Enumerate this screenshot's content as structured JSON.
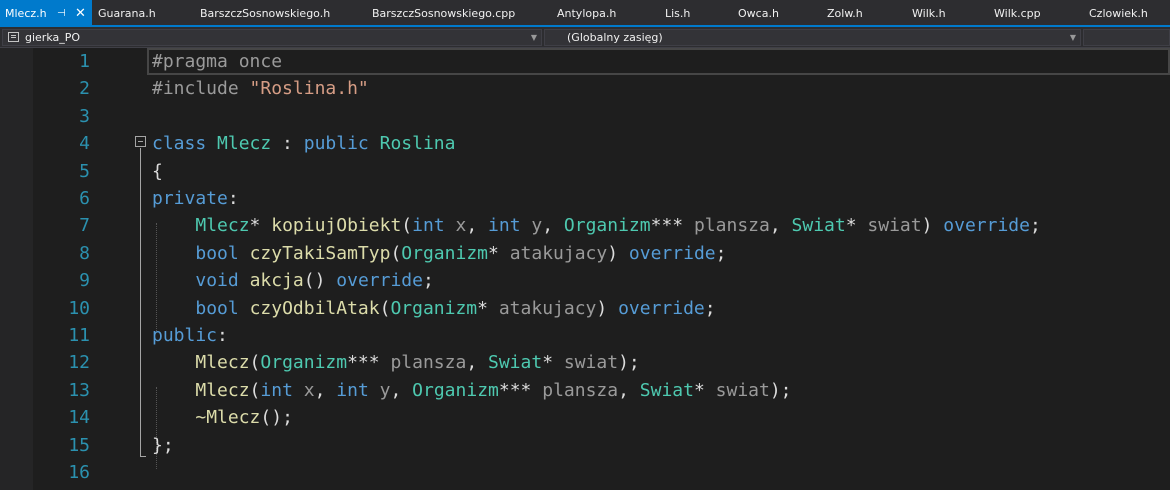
{
  "tabs": [
    {
      "label": "Mlecz.h",
      "active": true
    },
    {
      "label": "Guarana.h"
    },
    {
      "label": "BarszczSosnowskiego.h"
    },
    {
      "label": "BarszczSosnowskiego.cpp"
    },
    {
      "label": "Antylopa.h"
    },
    {
      "label": "Lis.h"
    },
    {
      "label": "Owca.h"
    },
    {
      "label": "Zolw.h"
    },
    {
      "label": "Wilk.h"
    },
    {
      "label": "Wilk.cpp"
    },
    {
      "label": "Czlowiek.h"
    }
  ],
  "navbar": {
    "project": "gierka_PO",
    "scope": "(Globalny zasięg)"
  },
  "colors": {
    "accent": "#007acc",
    "background": "#1e1e1e",
    "keyword": "#569cd6",
    "type": "#4ec9b0",
    "function": "#dcdcaa",
    "string": "#d69d85",
    "line_number": "#2b91af"
  },
  "lines": [
    {
      "n": "1",
      "tokens": [
        [
          "#pragma once",
          "pp"
        ]
      ]
    },
    {
      "n": "2",
      "tokens": [
        [
          "#include ",
          "pp"
        ],
        [
          "\"Roslina.h\"",
          "st"
        ]
      ]
    },
    {
      "n": "3",
      "tokens": []
    },
    {
      "n": "4",
      "tokens": [
        [
          "class",
          "kw"
        ],
        [
          " ",
          "pl"
        ],
        [
          "Mlecz",
          "ty"
        ],
        [
          " : ",
          "pl"
        ],
        [
          "public",
          "kw"
        ],
        [
          " ",
          "pl"
        ],
        [
          "Roslina",
          "ty"
        ]
      ]
    },
    {
      "n": "5",
      "tokens": [
        [
          "{",
          "pl"
        ]
      ]
    },
    {
      "n": "6",
      "tokens": [
        [
          "private",
          "kw"
        ],
        [
          ":",
          "pl"
        ]
      ]
    },
    {
      "n": "7",
      "tokens": [
        [
          "    ",
          "pl"
        ],
        [
          "Mlecz",
          "ty"
        ],
        [
          "* ",
          "pl"
        ],
        [
          "kopiujObiekt",
          "fn"
        ],
        [
          "(",
          "pl"
        ],
        [
          "int",
          "kw"
        ],
        [
          " ",
          "pl"
        ],
        [
          "x",
          "pr"
        ],
        [
          ", ",
          "pl"
        ],
        [
          "int",
          "kw"
        ],
        [
          " ",
          "pl"
        ],
        [
          "y",
          "pr"
        ],
        [
          ", ",
          "pl"
        ],
        [
          "Organizm",
          "ty"
        ],
        [
          "*** ",
          "pl"
        ],
        [
          "plansza",
          "pr"
        ],
        [
          ", ",
          "pl"
        ],
        [
          "Swiat",
          "ty"
        ],
        [
          "* ",
          "pl"
        ],
        [
          "swiat",
          "pr"
        ],
        [
          ") ",
          "pl"
        ],
        [
          "override",
          "kw"
        ],
        [
          ";",
          "pl"
        ]
      ]
    },
    {
      "n": "8",
      "tokens": [
        [
          "    ",
          "pl"
        ],
        [
          "bool",
          "kw"
        ],
        [
          " ",
          "pl"
        ],
        [
          "czyTakiSamTyp",
          "fn"
        ],
        [
          "(",
          "pl"
        ],
        [
          "Organizm",
          "ty"
        ],
        [
          "* ",
          "pl"
        ],
        [
          "atakujacy",
          "pr"
        ],
        [
          ") ",
          "pl"
        ],
        [
          "override",
          "kw"
        ],
        [
          ";",
          "pl"
        ]
      ]
    },
    {
      "n": "9",
      "tokens": [
        [
          "    ",
          "pl"
        ],
        [
          "void",
          "kw"
        ],
        [
          " ",
          "pl"
        ],
        [
          "akcja",
          "fn"
        ],
        [
          "() ",
          "pl"
        ],
        [
          "override",
          "kw"
        ],
        [
          ";",
          "pl"
        ]
      ]
    },
    {
      "n": "10",
      "tokens": [
        [
          "    ",
          "pl"
        ],
        [
          "bool",
          "kw"
        ],
        [
          " ",
          "pl"
        ],
        [
          "czyOdbilAtak",
          "fn"
        ],
        [
          "(",
          "pl"
        ],
        [
          "Organizm",
          "ty"
        ],
        [
          "* ",
          "pl"
        ],
        [
          "atakujacy",
          "pr"
        ],
        [
          ") ",
          "pl"
        ],
        [
          "override",
          "kw"
        ],
        [
          ";",
          "pl"
        ]
      ]
    },
    {
      "n": "11",
      "tokens": [
        [
          "public",
          "kw"
        ],
        [
          ":",
          "pl"
        ]
      ]
    },
    {
      "n": "12",
      "tokens": [
        [
          "    ",
          "pl"
        ],
        [
          "Mlecz",
          "fn"
        ],
        [
          "(",
          "pl"
        ],
        [
          "Organizm",
          "ty"
        ],
        [
          "*** ",
          "pl"
        ],
        [
          "plansza",
          "pr"
        ],
        [
          ", ",
          "pl"
        ],
        [
          "Swiat",
          "ty"
        ],
        [
          "* ",
          "pl"
        ],
        [
          "swiat",
          "pr"
        ],
        [
          ");",
          "pl"
        ]
      ]
    },
    {
      "n": "13",
      "tokens": [
        [
          "    ",
          "pl"
        ],
        [
          "Mlecz",
          "fn"
        ],
        [
          "(",
          "pl"
        ],
        [
          "int",
          "kw"
        ],
        [
          " ",
          "pl"
        ],
        [
          "x",
          "pr"
        ],
        [
          ", ",
          "pl"
        ],
        [
          "int",
          "kw"
        ],
        [
          " ",
          "pl"
        ],
        [
          "y",
          "pr"
        ],
        [
          ", ",
          "pl"
        ],
        [
          "Organizm",
          "ty"
        ],
        [
          "*** ",
          "pl"
        ],
        [
          "plansza",
          "pr"
        ],
        [
          ", ",
          "pl"
        ],
        [
          "Swiat",
          "ty"
        ],
        [
          "* ",
          "pl"
        ],
        [
          "swiat",
          "pr"
        ],
        [
          ");",
          "pl"
        ]
      ]
    },
    {
      "n": "14",
      "tokens": [
        [
          "    ",
          "pl"
        ],
        [
          "~Mlecz",
          "fn"
        ],
        [
          "();",
          "pl"
        ]
      ]
    },
    {
      "n": "15",
      "tokens": [
        [
          "};",
          "pl"
        ]
      ]
    },
    {
      "n": "16",
      "tokens": []
    }
  ]
}
